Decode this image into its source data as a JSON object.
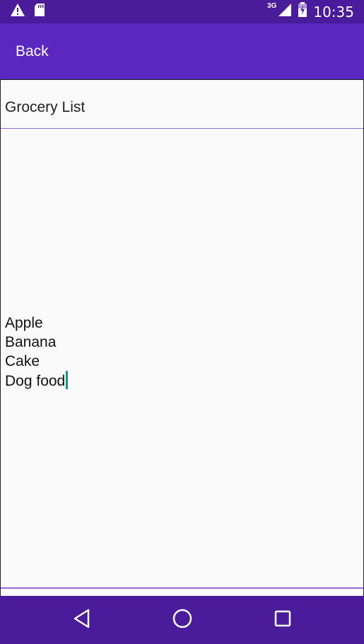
{
  "status_bar": {
    "time": "10:35",
    "network": "3G",
    "icons": [
      "warning-icon",
      "sd-card-icon",
      "signal-icon",
      "battery-icon"
    ]
  },
  "app_bar": {
    "back_label": "Back",
    "color": "#5b27c1"
  },
  "note": {
    "title": "Grocery List",
    "lines": [
      "Apple",
      "Banana",
      "Cake",
      "Dog food"
    ]
  },
  "nav_bar": {
    "buttons": [
      "back-nav-icon",
      "home-nav-icon",
      "recents-nav-icon"
    ]
  },
  "colors": {
    "status_bar": "#4a1c9b",
    "accent_line": "#9c6ad6",
    "cursor": "#109a88"
  }
}
